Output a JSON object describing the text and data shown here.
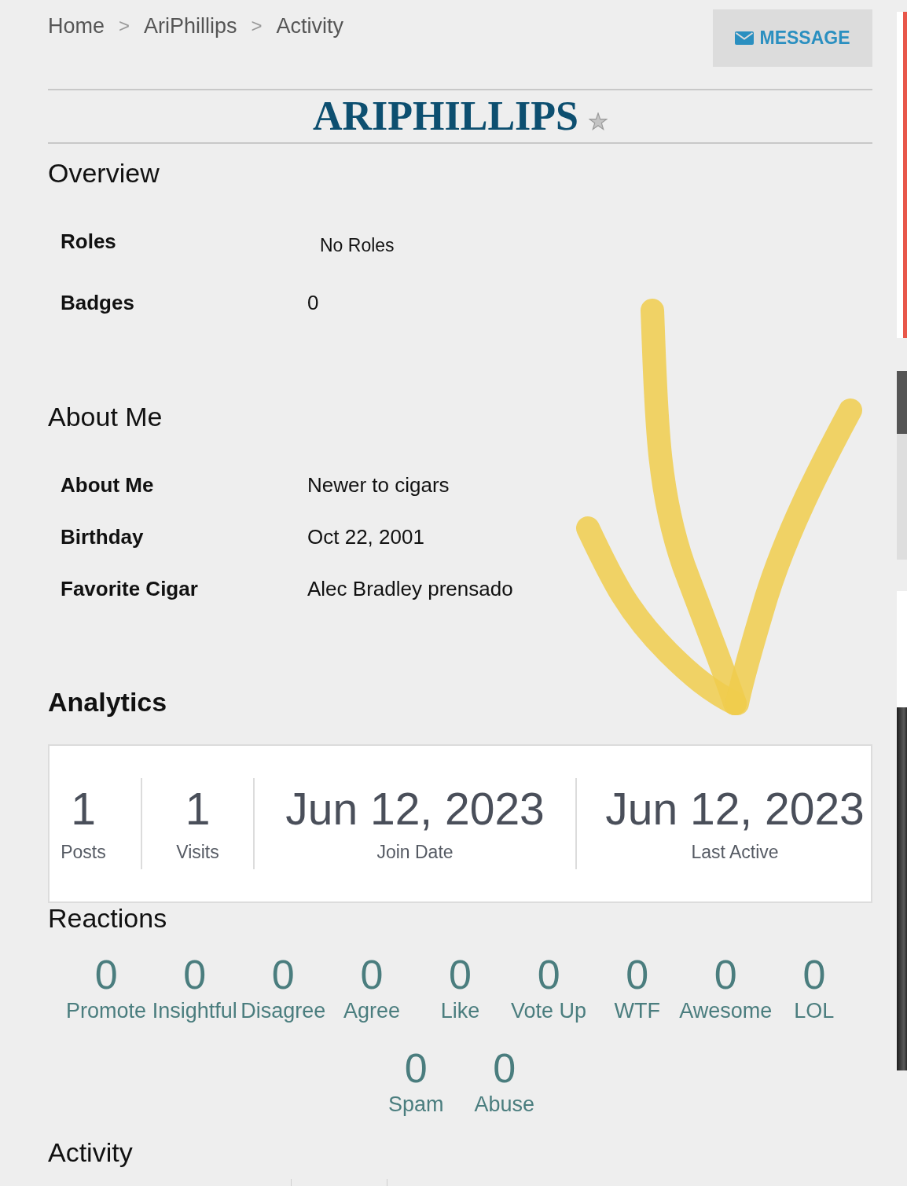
{
  "breadcrumb": [
    {
      "label": "Home",
      "separator": ">"
    },
    {
      "label": "AriPhillips",
      "separator": ">"
    },
    {
      "label": "Activity"
    }
  ],
  "message_button": {
    "label": "MESSAGE"
  },
  "profile": {
    "username": "ARIPHILLIPS"
  },
  "overview": {
    "title": "Overview",
    "rows": [
      {
        "label": "Roles",
        "value": "No Roles",
        "kind": "list"
      },
      {
        "label": "Badges",
        "value": "0",
        "kind": "text"
      }
    ]
  },
  "about_me": {
    "title": "About Me",
    "rows": [
      {
        "label": "About Me",
        "value": "Newer to cigars"
      },
      {
        "label": "Birthday",
        "value": "Oct 22, 2001"
      },
      {
        "label": "Favorite Cigar",
        "value": "Alec Bradley prensado"
      }
    ]
  },
  "analytics": {
    "title": "Analytics",
    "stats": [
      {
        "value": "1",
        "label": "Posts"
      },
      {
        "value": "1",
        "label": "Visits"
      },
      {
        "value": "Jun 12, 2023",
        "label": "Join Date"
      },
      {
        "value": "Jun 12, 2023",
        "label": "Last Active"
      }
    ]
  },
  "reactions": {
    "title": "Reactions",
    "items": [
      {
        "count": "0",
        "label": "Promote"
      },
      {
        "count": "0",
        "label": "Insightful"
      },
      {
        "count": "0",
        "label": "Disagree"
      },
      {
        "count": "0",
        "label": "Agree"
      },
      {
        "count": "0",
        "label": "Like"
      },
      {
        "count": "0",
        "label": "Vote Up"
      },
      {
        "count": "0",
        "label": "WTF"
      },
      {
        "count": "0",
        "label": "Awesome"
      },
      {
        "count": "0",
        "label": "LOL"
      },
      {
        "count": "0",
        "label": "Spam"
      },
      {
        "count": "0",
        "label": "Abuse"
      }
    ]
  },
  "activity": {
    "title": "Activity"
  }
}
